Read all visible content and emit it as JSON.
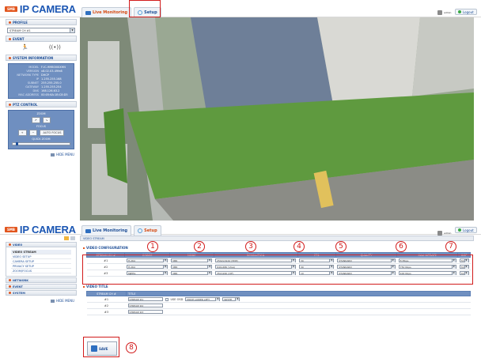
{
  "brand": {
    "badge": "SMB",
    "title": "IP CAMERA"
  },
  "top": {
    "tab_live": "Live Monitoring",
    "tab_setup": "Setup",
    "user": "admin",
    "logout": "Logout"
  },
  "sidebar": {
    "profile": "PROFILE",
    "stream": "STREAM CH #1",
    "event": "EVENT",
    "sysinfo": "SYSTEM INFORMATION",
    "info": [
      {
        "k": "MODEL",
        "v": "F-IC-9M8000IXHN"
      },
      {
        "k": "VERSION",
        "v": "v8.02.03-49fe8"
      },
      {
        "k": "NETWORK TYPE",
        "v": "DHCP"
      },
      {
        "k": "IP",
        "v": "1.255.255.168"
      },
      {
        "k": "SUBNET",
        "v": "255.255.255.0"
      },
      {
        "k": "GATEWAY",
        "v": "1.255.255.254"
      },
      {
        "k": "DNS",
        "v": "168.126.63.2"
      },
      {
        "k": "MAC ADDRESS",
        "v": "00:05:6A:1B:C8:D5"
      }
    ],
    "ptz": "PTZ CONTROL",
    "zoom": "ZOOM",
    "focus": "FOCUS",
    "auto_focus": "AUTO FOCUS",
    "quick_zoom": "QUICK ZOOM",
    "hide_menu": "HIDE MENU"
  },
  "menu": {
    "video": "VIDEO",
    "items": [
      "VIDEO STREAM",
      "VIDEO SETUP",
      "CAMERA SETUP",
      "PRIVACY SETUP",
      "ZOOM/FOCUS"
    ],
    "network": "NETWORK",
    "event": "EVENT",
    "system": "SYSTEM",
    "hide_menu": "HIDE MENU"
  },
  "content": {
    "crumb": "VIDEO STREAM",
    "cfg_title": "VIDEO CONFIGURATION",
    "cfg_headers": [
      "STREAM CH #",
      "CODEC",
      "MODE",
      "RESOLUTION",
      "FPS",
      "QUALITY",
      "MAX BITRATE",
      "GOP"
    ],
    "cfg_rows": [
      [
        "#1",
        "H.264",
        "VBR",
        "2592x1944 (5MP)",
        "30",
        "STANDARD",
        "8 Mbps",
        "30"
      ],
      [
        "#2",
        "H.264",
        "VBR",
        "640x480 (VGA)",
        "30",
        "STANDARD",
        "750 Kbps",
        "30"
      ],
      [
        "#3",
        "MJPEG",
        "VBR",
        "352x240 (CIF)",
        "10",
        "STANDARD",
        "400 Kbps",
        "30"
      ]
    ],
    "title_title": "VIDEO TITLE",
    "title_headers": [
      "STREAM CH #",
      "TITLE"
    ],
    "title_rows": [
      [
        "#1",
        "STREAM #1"
      ],
      [
        "#2",
        "STREAM #2"
      ],
      [
        "#3",
        "STREAM #3"
      ]
    ],
    "use_osd": "USE OSD",
    "osd_position": "MOVE LOWER LEFT",
    "osd_color": "WHITE",
    "save": "SAVE"
  },
  "annotations": [
    "1",
    "2",
    "3",
    "4",
    "5",
    "6",
    "7",
    "8"
  ],
  "colors": {
    "accent": "#d21b1b",
    "brand": "#1b56b3",
    "header_row": "#6f8fc0"
  }
}
